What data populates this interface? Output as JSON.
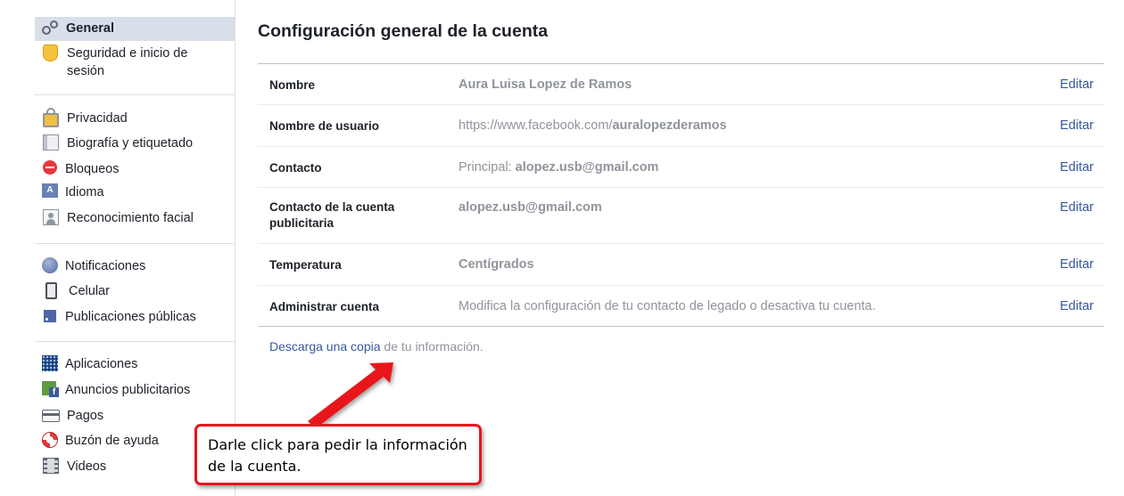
{
  "sidebar": {
    "groups": [
      [
        {
          "label": "General",
          "icon": "gear-icon",
          "active": true
        },
        {
          "label": "Seguridad e inicio de sesión",
          "icon": "shield-icon"
        }
      ],
      [
        {
          "label": "Privacidad",
          "icon": "lock-icon"
        },
        {
          "label": "Biografía y etiquetado",
          "icon": "timeline-icon"
        },
        {
          "label": "Bloqueos",
          "icon": "block-icon"
        },
        {
          "label": "Idioma",
          "icon": "language-icon"
        },
        {
          "label": "Reconocimiento facial",
          "icon": "face-recognition-icon"
        }
      ],
      [
        {
          "label": "Notificaciones",
          "icon": "globe-icon"
        },
        {
          "label": "Celular",
          "icon": "phone-icon"
        },
        {
          "label": "Publicaciones públicas",
          "icon": "rss-icon"
        }
      ],
      [
        {
          "label": "Aplicaciones",
          "icon": "apps-icon"
        },
        {
          "label": "Anuncios publicitarios",
          "icon": "ads-icon"
        },
        {
          "label": "Pagos",
          "icon": "card-icon"
        },
        {
          "label": "Buzón de ayuda",
          "icon": "help-icon"
        },
        {
          "label": "Videos",
          "icon": "video-icon"
        }
      ]
    ]
  },
  "main": {
    "title": "Configuración general de la cuenta",
    "edit_label": "Editar",
    "rows": [
      {
        "label": "Nombre",
        "value_plain": "",
        "value_bold": "Aura Luisa Lopez de Ramos"
      },
      {
        "label": "Nombre de usuario",
        "value_plain": "https://www.facebook.com/",
        "value_bold": "auralopezderamos"
      },
      {
        "label": "Contacto",
        "value_plain": "Principal: ",
        "value_bold": "alopez.usb@gmail.com"
      },
      {
        "label": "Contacto de la cuenta publicitaria",
        "value_plain": "",
        "value_bold": "alopez.usb@gmail.com"
      },
      {
        "label": "Temperatura",
        "value_plain": "",
        "value_bold": "Centígrados"
      },
      {
        "label": "Administrar cuenta",
        "value_plain": "Modifica la configuración de tu contacto de legado o desactiva tu cuenta.",
        "value_bold": ""
      }
    ],
    "download": {
      "link": "Descarga una copia",
      "rest": " de tu información."
    }
  },
  "callout": {
    "text": "Darle click para pedir la información de la cuenta.",
    "color": "#e8141a"
  }
}
